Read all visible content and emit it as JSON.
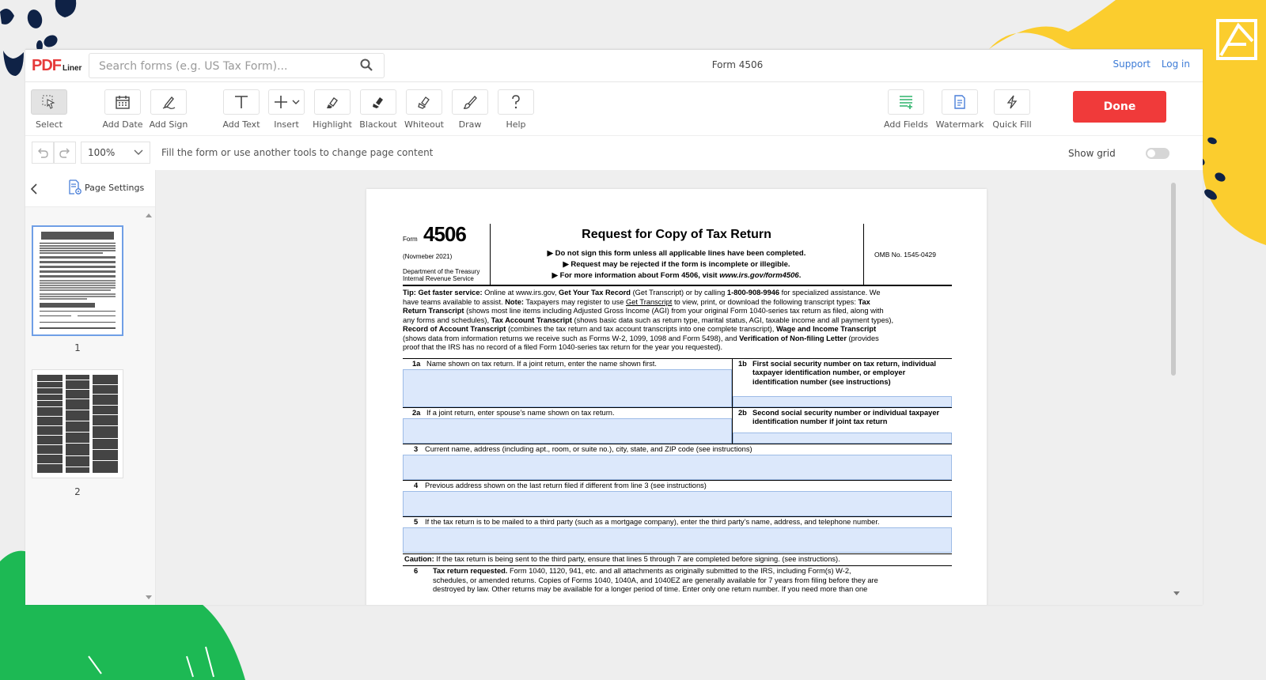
{
  "app": {
    "logo_main": "PDF",
    "logo_sub": "Liner",
    "search_placeholder": "Search forms (e.g. US Tax Form)...",
    "document_title": "Form 4506",
    "links": {
      "support": "Support",
      "login": "Log in"
    }
  },
  "toolbar": {
    "select": "Select",
    "add_date": "Add Date",
    "add_sign": "Add Sign",
    "add_text": "Add Text",
    "insert": "Insert",
    "highlight": "Highlight",
    "blackout": "Blackout",
    "whiteout": "Whiteout",
    "draw": "Draw",
    "help": "Help",
    "add_fields": "Add Fields",
    "watermark": "Watermark",
    "quick_fill": "Quick Fill",
    "done": "Done"
  },
  "subbar": {
    "zoom": "100%",
    "hint": "Fill the form or use another tools to change page content",
    "show_grid": "Show grid",
    "grid_on": false
  },
  "sidebar": {
    "page_settings": "Page Settings",
    "pages": [
      "1",
      "2"
    ],
    "selected_page": "1"
  },
  "form": {
    "form_word": "Form",
    "form_number": "4506",
    "revision": "(Novmeber 2021)",
    "dept_line1": "Department of the Treasury",
    "dept_line2": "Internal Revenue Service",
    "title": "Request for Copy of Tax Return",
    "notice1": "▶ Do not sign this form unless all applicable lines have been completed.",
    "notice2": "▶ Request may be rejected if the form is incomplete or illegible.",
    "notice3_prefix": "▶ For more information about Form 4506, visit ",
    "notice3_url": "www.irs.gov/form4506",
    "notice3_suffix": ".",
    "omb": "OMB No. 1545-0429",
    "tip": {
      "l1_a": "Tip: Get faster service:",
      "l1_b": " Online at www.irs.gov, ",
      "l1_c": "Get Your Tax Record",
      "l1_d": " (Get Transcript) or by calling ",
      "l1_e": "1-800-908-9946",
      "l1_f": " for specialized assistance. We",
      "l2_a": "have teams available to assist. ",
      "l2_b": "Note:",
      "l2_c": " Taxpayers may register to use ",
      "l2_d": "Get Transcript",
      "l2_e": " to view, print, or download the following transcript types: ",
      "l2_f": "Tax",
      "l3_a": "Return Transcript",
      "l3_b": " (shows most line items including Adjusted Gross Income (AGI) from your original Form 1040-series tax return as filed, along with",
      "l4_a": "any forms and schedules), ",
      "l4_b": "Tax Account Transcript",
      "l4_c": " (shows basic data such as return type, marital status, AGI, taxable income and all payment types),",
      "l5_a": "Record of Account Transcript",
      "l5_b": " (combines the tax return and tax account transcripts into one complete transcript), ",
      "l5_c": "Wage and Income Transcript",
      "l6_a": "(shows data from information returns we receive such as Forms W-2, 1099, 1098 and Form 5498), and ",
      "l6_b": "Verification of Non-filing Letter",
      "l6_c": " (provides",
      "l7": "proof that the IRS has no record of a filed Form 1040-series tax return for the year you requested)."
    },
    "line1a_num": "1a",
    "line1a": "Name shown on tax return. If a joint return, enter the name shown first.",
    "line1b_num": "1b",
    "line1b": "First social security number on tax return, individual taxpayer identification number, or employer identification number (see instructions)",
    "line2a_num": "2a",
    "line2a": "If a joint return, enter spouse’s name shown on tax return.",
    "line2b_num": "2b",
    "line2b": "Second social security number or individual taxpayer identification number if joint tax return",
    "line3_num": "3",
    "line3": "Current name, address (including apt., room, or suite no.), city, state, and ZIP code (see instructions)",
    "line4_num": "4",
    "line4": "Previous address shown on the last return filed if different from line 3 (see instructions)",
    "line5_num": "5",
    "line5": "If the tax return is to be mailed to a third party (such as a mortgage company), enter the third party’s name, address, and telephone number.",
    "caution_label": "Caution:",
    "caution": " If the tax return is being sent to the third party, ensure that lines 5 through 7 are completed before signing. (see instructions).",
    "line6_num": "6",
    "line6_title": "Tax return requested.",
    "line6_l1": " Form 1040, 1120, 941, etc. and all attachments as originally submitted to the IRS, including Form(s) W-2,",
    "line6_l2": "schedules, or amended returns. Copies of Forms 1040, 1040A, and 1040EZ are generally available for 7 years from filing before they are",
    "line6_l3": "destroyed by law. Other returns may be available for a longer period of time. Enter only one return number. If you need more than one"
  },
  "colors": {
    "accent": "#f03a3a",
    "link": "#3c7bd6",
    "field_fill": "#dce8fb",
    "deco_green": "#1db954",
    "deco_yellow": "#fbcd2e",
    "deco_navy": "#0f2246"
  }
}
